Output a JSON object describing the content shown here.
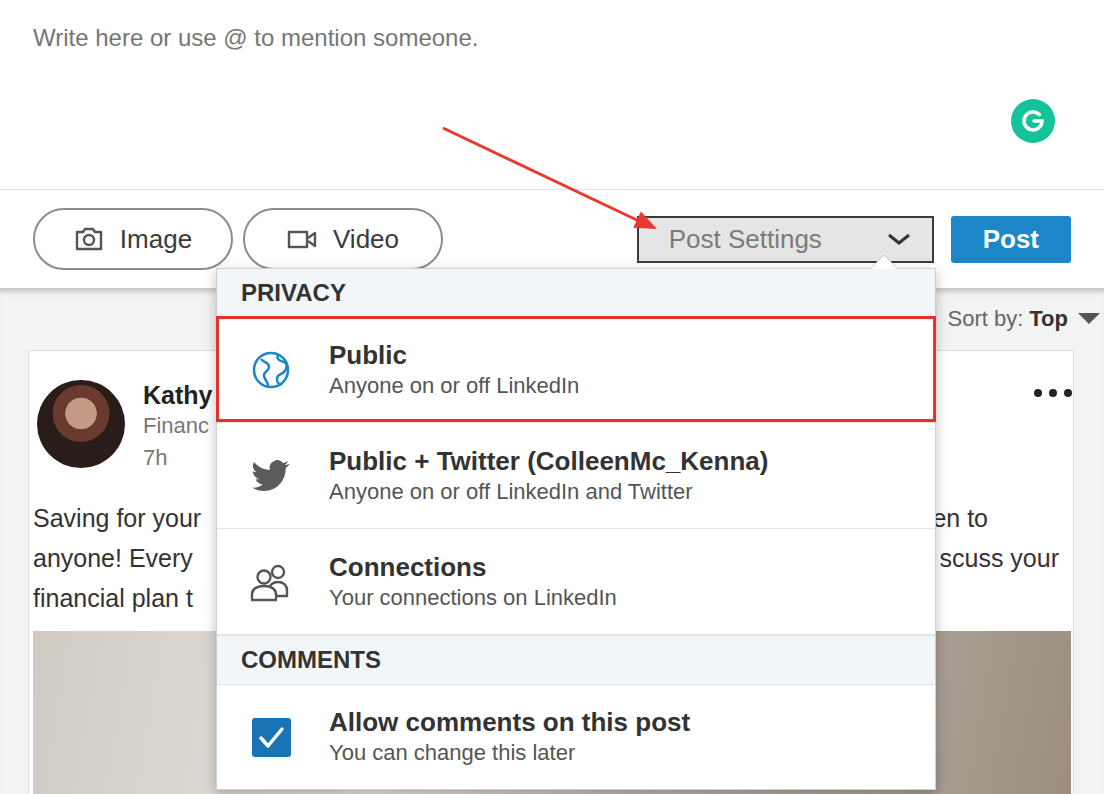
{
  "composer": {
    "placeholder": "Write here or use @ to mention someone."
  },
  "toolbar": {
    "media_buttons": [
      {
        "label": "Image",
        "kind": "image"
      },
      {
        "label": "Video",
        "kind": "video"
      }
    ],
    "post_settings": "Post Settings",
    "post": "Post"
  },
  "feed": {
    "sort": {
      "label": "Sort by:",
      "value": "Top"
    },
    "post": {
      "author": "Kathy",
      "headline": "Financ",
      "time": "7h",
      "lines": [
        {
          "left": "Saving for your",
          "right": "en to"
        },
        {
          "left": "anyone! Every",
          "right": "scuss your"
        },
        {
          "left": "financial plan t"
        }
      ]
    }
  },
  "settings_menu": {
    "privacy_header": "PRIVACY",
    "privacy_options": [
      {
        "title": "Public",
        "subtitle": "Anyone on or off LinkedIn",
        "kind": "public",
        "highlighted": true
      },
      {
        "title": "Public + Twitter (ColleenMc_Kenna)",
        "subtitle": "Anyone on or off LinkedIn and Twitter",
        "kind": "twitter",
        "highlighted": false
      },
      {
        "title": "Connections",
        "subtitle": "Your connections on LinkedIn",
        "kind": "connections",
        "highlighted": false
      }
    ],
    "comments_header": "COMMENTS",
    "comments_option": {
      "title": "Allow comments on this post",
      "subtitle": "You can change this later",
      "checked": true
    }
  }
}
